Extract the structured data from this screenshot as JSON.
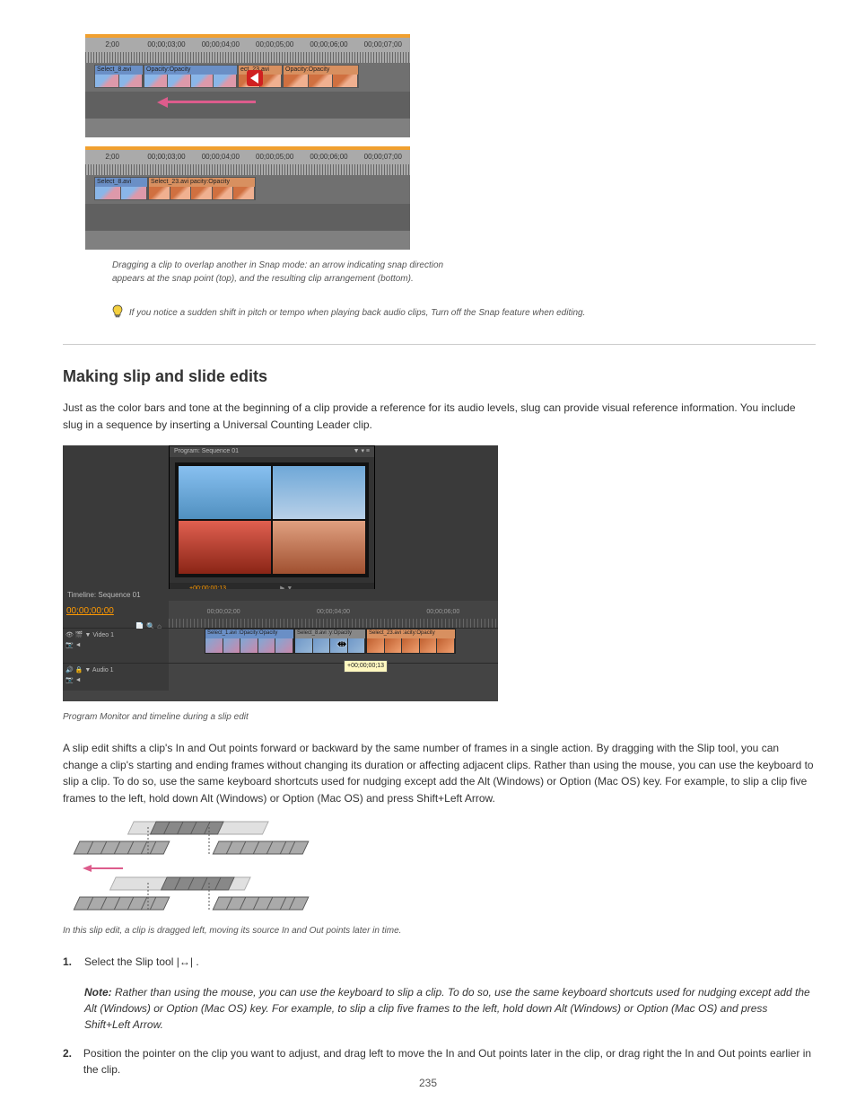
{
  "timeline1": {
    "ruler_ticks": [
      "2;00",
      "00;00;03;00",
      "00;00;04;00",
      "00;00;05;00",
      "00;00;06;00",
      "00;00;07;00"
    ],
    "clip1_label": "Select_8.avi",
    "clip2_label": "Opacity:Opacity",
    "clip3_label": "ect_23.avi",
    "clip4_label": "Opacity:Opacity"
  },
  "timeline2": {
    "ruler_ticks": [
      "2;00",
      "00;00;03;00",
      "00;00;04;00",
      "00;00;05;00",
      "00;00;06;00",
      "00;00;07;00"
    ],
    "clip1_label": "Select_8.avi",
    "clip2_label": "Select_23.avi",
    "clip2_label2": "pacity:Opacity"
  },
  "caption1": "Dragging a clip to overlap another in Snap mode: an arrow indicating snap direction appears at the snap point (top), and the resulting clip arrangement (bottom).",
  "tip": "If you notice a sudden shift in pitch or tempo when playing back audio clips, Turn off the Snap feature when editing.",
  "section_title": "Making slip and slide edits",
  "para1": "Just as the color bars and tone at the beginning of a clip provide a reference for its audio levels, slug can provide visual reference information. You include slug in a sequence by inserting a Universal Counting Leader clip.",
  "seq": {
    "prog_title": "Program: Sequence 01",
    "prog_time": "+00;00;00;13",
    "prog_icon1": "▶",
    "prog_icon2": "▼",
    "tab_title": "Timeline: Sequence 01",
    "master_time": "00;00;00;00",
    "ruler": [
      "00;00;02;00",
      "00;00;04;00",
      "00;00;06;00"
    ],
    "video_label": "Video 1",
    "track_icons1": "👁 🎬  ▼",
    "track_icons2": "📷 ◄",
    "audio_label": "Audio 1",
    "audio_icons1": "🔊 🔒  ▼",
    "audio_icons2": "📷 ◄",
    "clip1": "Select_1.avi :Opacity:Opacity",
    "clip2": "Select_8.avi :y:Opacity",
    "clip3": "Select_23.avi :acity:Opacity",
    "tooltip": "+00;00;00;13"
  },
  "caption2": "Program Monitor and timeline during a slip edit",
  "para2": "A slip edit shifts a clip's In and Out points forward or backward by the same number of frames in a single action. By dragging with the Slip tool, you can change a clip's starting and ending frames without changing its duration or affecting adjacent clips. Rather than using the mouse, you can use the keyboard to slip a clip. To do so, use the same keyboard shortcuts used for nudging except add the Alt (Windows) or Option (Mac OS) key. For example, to slip a clip five frames to the left, hold down Alt (Windows) or Option (Mac OS) and press Shift+Left Arrow.",
  "caption3": "In this slip edit, a clip is dragged left, moving its source In and Out points later in time.",
  "step1_num": "1.",
  "step1_text": "Select the Slip tool ",
  "step1_glyph": "|↔|",
  "step1_text2": ".",
  "note_label": "Note:",
  "note_body": "Rather than using the mouse, you can use the keyboard to slip a clip. To do so, use the same keyboard shortcuts used for nudging except add the Alt (Windows) or Option (Mac OS) key. For example, to slip a clip five frames to the left, hold down Alt (Windows) or Option (Mac OS) and press Shift+Left Arrow.",
  "step2_num": "2.",
  "step2_text": "Position the pointer on the clip you want to adjust, and drag left to move the In and Out points later in the clip, or drag right the In and Out points earlier in the clip.",
  "page_number": "235"
}
